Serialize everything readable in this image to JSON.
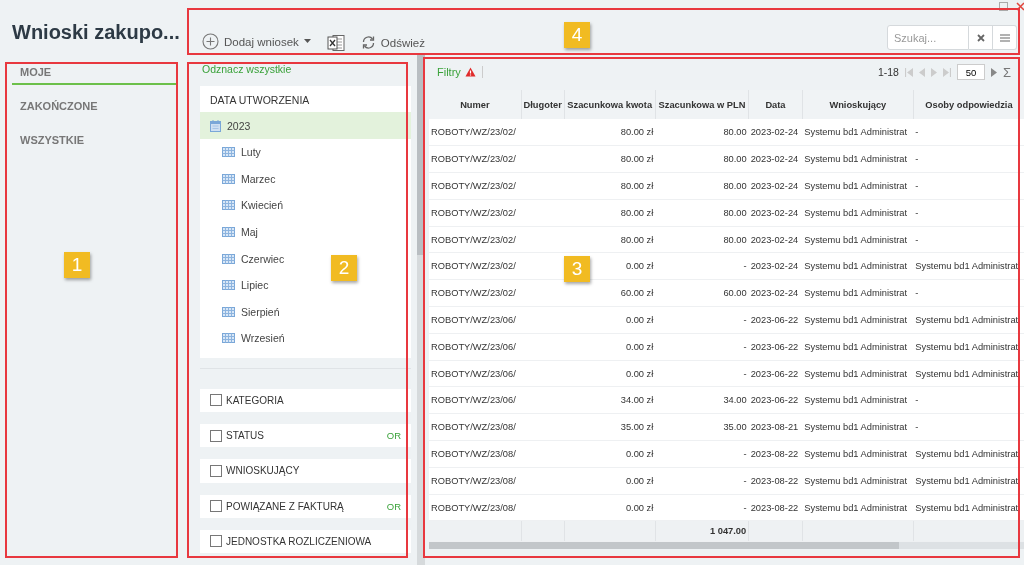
{
  "window": {
    "title": "Wnioski zakupo..."
  },
  "nav": [
    {
      "label": "MOJE",
      "selected": true
    },
    {
      "label": "ZAKOŃCZONE",
      "selected": false
    },
    {
      "label": "WSZYSTKIE",
      "selected": false
    }
  ],
  "toolbar": {
    "add_button": "Dodaj wniosek",
    "refresh_button": "Odśwież",
    "search": {
      "placeholder": "Szukaj..."
    }
  },
  "filter_panel": {
    "deselect_all": "Odznacz wszystkie",
    "date_tree": {
      "title": "DATA UTWORZENIA",
      "items": [
        {
          "label": "2023",
          "selected": true,
          "children": [
            {
              "label": "Luty",
              "selected": false
            },
            {
              "label": "Marzec",
              "selected": false
            },
            {
              "label": "Kwiecień",
              "selected": false
            },
            {
              "label": "Maj",
              "selected": false
            },
            {
              "label": "Czerwiec",
              "selected": false
            },
            {
              "label": "Lipiec",
              "selected": false
            },
            {
              "label": "Sierpień",
              "selected": false
            },
            {
              "label": "Wrzesień",
              "selected": false
            }
          ]
        }
      ]
    },
    "filters": [
      {
        "label": "KATEGORIA",
        "checked": false
      },
      {
        "label": "STATUS",
        "checked": false,
        "operator": "OR"
      },
      {
        "label": "WNIOSKUJĄCY",
        "checked": false
      },
      {
        "label": "POWIĄZANE Z FAKTURĄ",
        "checked": false,
        "operator": "OR"
      },
      {
        "label": "JEDNOSTKA ROZLICZENIOWA",
        "checked": false
      }
    ]
  },
  "grid": {
    "filters_tab": "Filtry",
    "range": "1-18",
    "page_size": "50",
    "sum_symbol": "Σ",
    "columns": [
      "Numer",
      "Długoter",
      "Szacunkowa kwota",
      "Szacunkowa w PLN",
      "Data",
      "Wnioskujący",
      "Osoby odpowiedzia"
    ],
    "rows": [
      [
        "ROBOTY/WZ/23/02/",
        "",
        "80.00 zł",
        "80.00",
        "2023-02-24",
        "Systemu bd1 Administrat",
        "-"
      ],
      [
        "ROBOTY/WZ/23/02/",
        "",
        "80.00 zł",
        "80.00",
        "2023-02-24",
        "Systemu bd1 Administrat",
        "-"
      ],
      [
        "ROBOTY/WZ/23/02/",
        "",
        "80.00 zł",
        "80.00",
        "2023-02-24",
        "Systemu bd1 Administrat",
        "-"
      ],
      [
        "ROBOTY/WZ/23/02/",
        "",
        "80.00 zł",
        "80.00",
        "2023-02-24",
        "Systemu bd1 Administrat",
        "-"
      ],
      [
        "ROBOTY/WZ/23/02/",
        "",
        "80.00 zł",
        "80.00",
        "2023-02-24",
        "Systemu bd1 Administrat",
        "-"
      ],
      [
        "ROBOTY/WZ/23/02/",
        "",
        "0.00 zł",
        "-",
        "2023-02-24",
        "Systemu bd1 Administrat",
        "Systemu bd1 Administrat"
      ],
      [
        "ROBOTY/WZ/23/02/",
        "",
        "60.00 zł",
        "60.00",
        "2023-02-24",
        "Systemu bd1 Administrat",
        "-"
      ],
      [
        "ROBOTY/WZ/23/06/",
        "",
        "0.00 zł",
        "-",
        "2023-06-22",
        "Systemu bd1 Administrat",
        "Systemu bd1 Administrat"
      ],
      [
        "ROBOTY/WZ/23/06/",
        "",
        "0.00 zł",
        "-",
        "2023-06-22",
        "Systemu bd1 Administrat",
        "Systemu bd1 Administrat"
      ],
      [
        "ROBOTY/WZ/23/06/",
        "",
        "0.00 zł",
        "-",
        "2023-06-22",
        "Systemu bd1 Administrat",
        "Systemu bd1 Administrat"
      ],
      [
        "ROBOTY/WZ/23/06/",
        "",
        "34.00 zł",
        "34.00",
        "2023-06-22",
        "Systemu bd1 Administrat",
        "-"
      ],
      [
        "ROBOTY/WZ/23/08/",
        "",
        "35.00 zł",
        "35.00",
        "2023-08-21",
        "Systemu bd1 Administrat",
        "-"
      ],
      [
        "ROBOTY/WZ/23/08/",
        "",
        "0.00 zł",
        "-",
        "2023-08-22",
        "Systemu bd1 Administrat",
        "Systemu bd1 Administrat"
      ],
      [
        "ROBOTY/WZ/23/08/",
        "",
        "0.00 zł",
        "-",
        "2023-08-22",
        "Systemu bd1 Administrat",
        "Systemu bd1 Administrat"
      ],
      [
        "ROBOTY/WZ/23/08/",
        "",
        "0.00 zł",
        "-",
        "2023-08-22",
        "Systemu bd1 Administrat",
        "Systemu bd1 Administrat"
      ]
    ],
    "total_in_pln": "1 047.00"
  },
  "annotations": [
    {
      "label": "4"
    },
    {
      "label": "1"
    },
    {
      "label": "2"
    },
    {
      "label": "3"
    }
  ]
}
